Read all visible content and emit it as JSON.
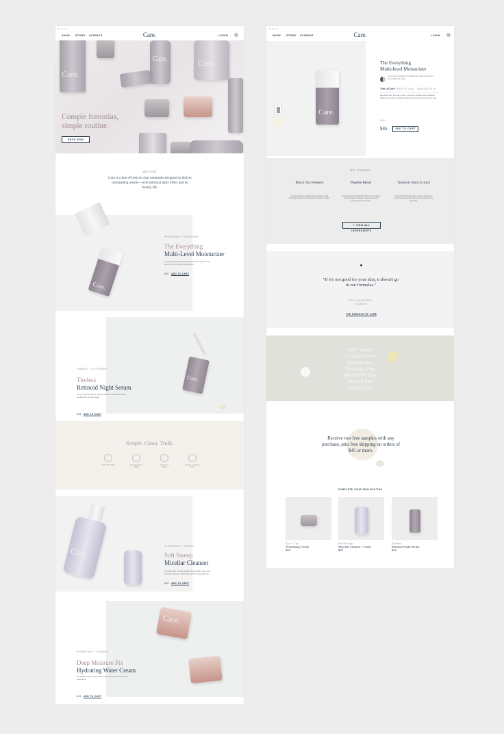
{
  "nav": {
    "shop": "SHOP",
    "story": "STORY",
    "science": "SCIENCE",
    "logo": "Care.",
    "login": "LOGIN"
  },
  "hero": {
    "title": "Comple formulas, simple routine.",
    "cta": "SHOP NOW",
    "brand": "Care."
  },
  "welcome": {
    "kicker": "WELCOME",
    "text": "Care is a line of best-in-class essentials designed to deliver outstanding results—with minimal daily effort and no beauty BS."
  },
  "products": [
    {
      "kicker": "HYDRATING + REPAIRING",
      "name_light": "The Everything",
      "name": "Multi-Level Moisturizer",
      "desc": "A supremely restorative that packs the power of a serum in the comfort of a cream.",
      "price": "$45",
      "cta": "ADD TO CART"
    },
    {
      "kicker": "FIRMING + SOFTENING",
      "name_light": "Tireless",
      "name": "Retinoid Night Serum",
      "desc": "A truly transformative night treatment that renews and repairs skin as you sleep.",
      "price": "$36",
      "cta": "ADD TO CART"
    },
    {
      "kicker": "CLEANSING + TONING",
      "name_light": "Soft Sweep",
      "name": "Micellar Cleanser",
      "desc": "The first step in your routine, this gentle, rinse-free formula cleanses effectively without stripping skin.",
      "price": "$28",
      "cta": "ADD TO CART"
    },
    {
      "kicker": "HYDRATING + CALMING",
      "name_light": "Deep Moisture Fix",
      "name": "Hydrating Water Cream",
      "desc": "An additionally rich gel cream that revives thirsty skin all week long.",
      "price": "$34",
      "cta": "ADD TO CART"
    }
  ],
  "truth": {
    "title": "Simple. Clean. Truth.",
    "badges": [
      "NOT TESTED",
      "FRAGRANCE FREE",
      "CRUELTY FREE",
      "MADE IN THE USA"
    ]
  },
  "detail": {
    "title_light": "The Everything",
    "title": "Multi-level Moisturizer",
    "tagline": "A supremely restorative that packs the power of a serum in the comfort of a cream.",
    "tabs": [
      "THE STORY",
      "HOW TO USE",
      "INGREDIENTS"
    ],
    "body": "Essential to any skincare routine, multi-level hydration that intelligently balances skin while soothing irritation and reducing the look of fine lines.",
    "size_label": "50ml",
    "price": "$45",
    "cta": "ADD TO CART"
  },
  "how": {
    "kicker": "WHY IT WORKS",
    "ingredients": [
      {
        "name": "Black Tea Ferment",
        "desc": "A natural grade fermentation of sweet black tea that boosts skin's radiance while fighting the effects of aging."
      },
      {
        "name": "Peptide Blend",
        "desc": "A special blend of Palmitoyl Tripeptide-1 & 7 stimulate the regeneration of collagen, renewing skin and reducing lines and wrinkles."
      },
      {
        "name": "Turmeric Root Extract",
        "desc": "A powerful natural antioxidant to protect against free radicals and a restorative for skin, improving skin tone and clarity."
      }
    ],
    "cta": "+ VIEW ALL INGREDIENTS"
  },
  "quote": {
    "text": "\"If it's not good for your skin, it doesn't go in our formulas.\"",
    "author": "PILAR BOUNTERS, FOUNDER",
    "cta": "THE ESSENCE OF CARE"
  },
  "free_list": [
    "RIPT Tested",
    "Fragrance Free",
    "Paraben Free",
    "Phthalates Free",
    "Mineral Oil Free",
    "Alcohol Free",
    "Cruelty Free"
  ],
  "samples": {
    "text": "Receive two free samples with any purchase, plus free shipping on orders of $45 or more."
  },
  "routine": {
    "title": "COMPLETE YOUR SKIN ROUTINE",
    "items": [
      {
        "light": "Eye + Lip",
        "name": "Nourishing Cream",
        "price": "$30"
      },
      {
        "light": "Soft Sweep",
        "name": "Micellar Cleanser + Toner",
        "price": "$28"
      },
      {
        "light": "Tireless",
        "name": "Retinoid Night Serum",
        "price": "$36"
      }
    ]
  },
  "colors": {
    "navy": "#1f3545",
    "mauve": "#a69296",
    "bg": "#ededee"
  }
}
